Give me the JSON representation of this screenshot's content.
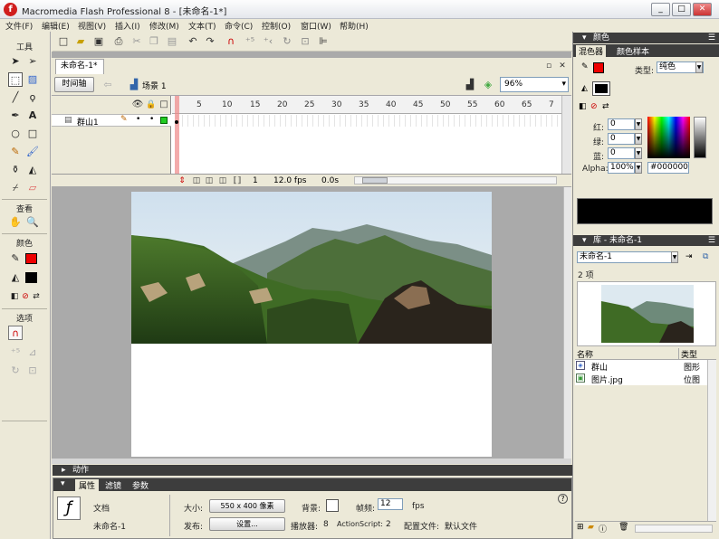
{
  "window": {
    "title": "Macromedia Flash Professional 8 - [未命名-1*]",
    "logo": "f",
    "min": "_",
    "max": "□",
    "close": "✕"
  },
  "menu": [
    "文件(F)",
    "编辑(E)",
    "视图(V)",
    "插入(I)",
    "修改(M)",
    "文本(T)",
    "命令(C)",
    "控制(O)",
    "窗口(W)",
    "帮助(H)"
  ],
  "tools": {
    "header": "工具",
    "view_header": "查看",
    "color_header": "颜色",
    "options_header": "选项"
  },
  "document": {
    "tab": "未命名-1*",
    "timeline_button": "时间轴",
    "scene": "场景 1",
    "zoom": "96%"
  },
  "timeline": {
    "layer_name": "群山1",
    "ruler": [
      "5",
      "10",
      "15",
      "20",
      "25",
      "30",
      "35",
      "40",
      "45",
      "50",
      "55",
      "60",
      "65",
      "7"
    ],
    "current_frame": "1",
    "frame_rate": "12.0 fps",
    "elapsed": "0.0s"
  },
  "panels": {
    "actions_title": "动作",
    "props_tabs": [
      "属性",
      "滤镜",
      "参数"
    ],
    "props": {
      "doc_label": "文档",
      "doc_name": "未命名-1",
      "size_label": "大小:",
      "size_value": "550 x 400 像素",
      "bg_label": "背景:",
      "fps_label": "帧频:",
      "fps_value": "12",
      "fps_unit": "fps",
      "publish_label": "发布:",
      "settings_button": "设置...",
      "player_label": "播放器:",
      "player_value": "8",
      "as_label": "ActionScript:",
      "as_value": "2",
      "profile_label": "配置文件:",
      "profile_value": "默认文件",
      "help": "?"
    }
  },
  "color_panel": {
    "title": "颜色",
    "tabs": [
      "混色器",
      "颜色样本"
    ],
    "type_label": "类型:",
    "type_value": "纯色",
    "red_label": "红:",
    "red": "0",
    "green_label": "绿:",
    "green": "0",
    "blue_label": "蓝:",
    "blue": "0",
    "alpha_label": "Alpha:",
    "alpha": "100%",
    "hex": "#000000"
  },
  "library": {
    "title": "库 - 未命名-1",
    "doc_select": "未命名-1",
    "count": "2 项",
    "col_name": "名称",
    "col_type": "类型",
    "items": [
      {
        "name": "群山",
        "type": "图形"
      },
      {
        "name": "图片.jpg",
        "type": "位图"
      }
    ]
  }
}
